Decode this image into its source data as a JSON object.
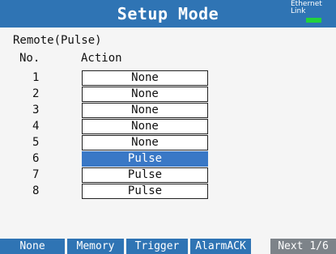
{
  "header": {
    "title": "Setup Mode",
    "ethernet_line1": "Ethernet",
    "ethernet_line2": "Link",
    "link_led_color": "#22d23c"
  },
  "panel": {
    "section_title": "Remote(Pulse)",
    "col_no": "No.",
    "col_action": "Action",
    "rows": [
      {
        "no": "1",
        "action": "None"
      },
      {
        "no": "2",
        "action": "None"
      },
      {
        "no": "3",
        "action": "None"
      },
      {
        "no": "4",
        "action": "None"
      },
      {
        "no": "5",
        "action": "None"
      },
      {
        "no": "6",
        "action": "Pulse",
        "selected": true
      },
      {
        "no": "7",
        "action": "Pulse"
      },
      {
        "no": "8",
        "action": "Pulse"
      }
    ]
  },
  "softkeys": {
    "none": "None",
    "memory": "Memory",
    "trigger": "Trigger",
    "alarmack": "AlarmACK",
    "next": "Next 1/6"
  },
  "colors": {
    "title_bar": "#2f74b4",
    "selected_row": "#3a78c6",
    "next_key": "#7d8389"
  }
}
